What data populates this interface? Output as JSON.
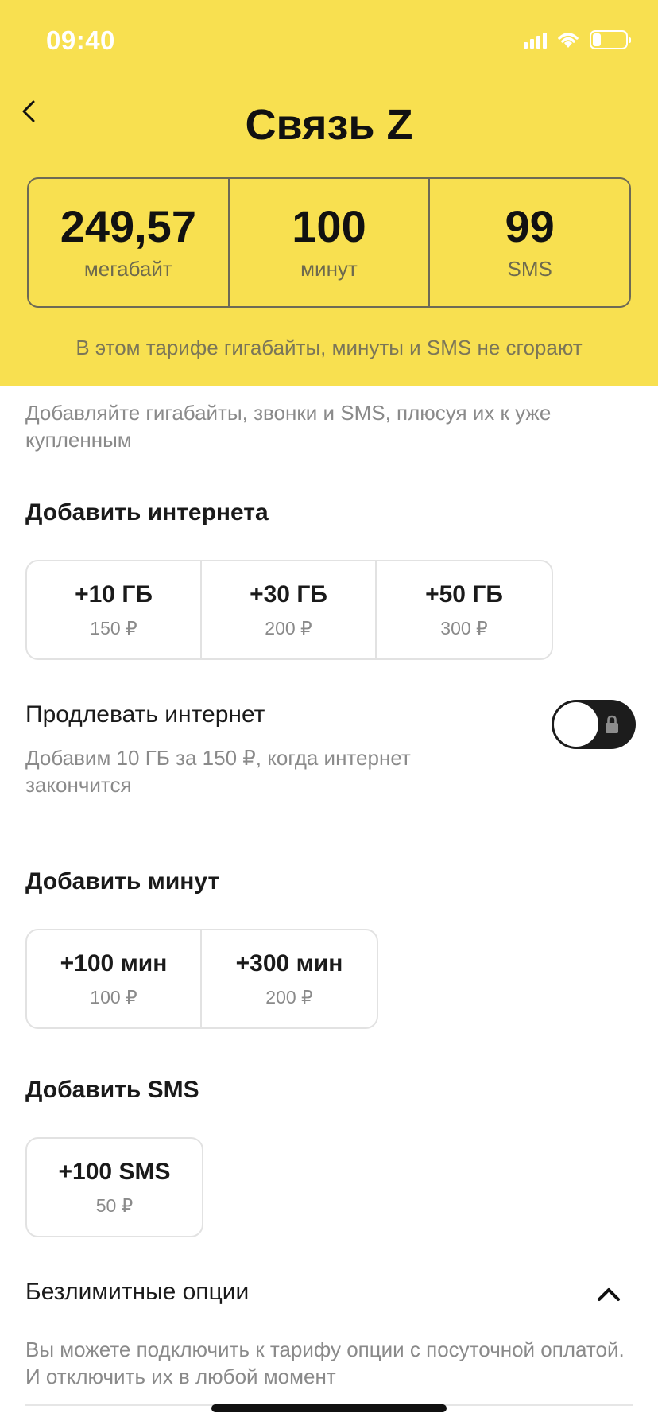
{
  "status_bar": {
    "time": "09:40"
  },
  "header": {
    "title": "Связь Z",
    "balances": [
      {
        "value": "249,57",
        "unit": "мегабайт"
      },
      {
        "value": "100",
        "unit": "минут"
      },
      {
        "value": "99",
        "unit": "SMS"
      }
    ],
    "note": "В этом тарифе гигабайты, минуты и SMS не сгорают"
  },
  "intro": "Добавляйте гигабайты, звонки и SMS, плюсуя их к уже купленным",
  "internet": {
    "title": "Добавить интернета",
    "options": [
      {
        "label": "+10 ГБ",
        "price": "150 ₽"
      },
      {
        "label": "+30 ГБ",
        "price": "200 ₽"
      },
      {
        "label": "+50 ГБ",
        "price": "300 ₽"
      }
    ]
  },
  "renew": {
    "title": "Продлевать интернет",
    "description": "Добавим 10 ГБ за 150 ₽, когда интернет закончится",
    "enabled": false
  },
  "minutes": {
    "title": "Добавить минут",
    "options": [
      {
        "label": "+100 мин",
        "price": "100 ₽"
      },
      {
        "label": "+300 мин",
        "price": "200 ₽"
      }
    ]
  },
  "sms": {
    "title": "Добавить SMS",
    "options": [
      {
        "label": "+100 SMS",
        "price": "50 ₽"
      }
    ]
  },
  "unlimited": {
    "title": "Безлимитные опции",
    "description": "Вы можете подключить к тарифу опции с посуточной оплатой. И отключить их в любой момент"
  },
  "colors": {
    "header_bg": "#f8e050",
    "toggle_bg": "#1c1c1c"
  }
}
